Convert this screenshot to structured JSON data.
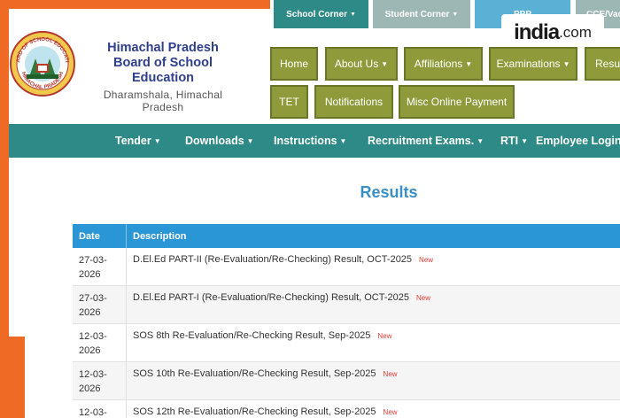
{
  "top_tabs": {
    "school_corner": "School Corner",
    "student_corner": "Student Corner",
    "c": "PPP",
    "d": "CCE/Vac"
  },
  "watermark": {
    "brand": "india",
    "suffix": ".com"
  },
  "org": {
    "line1": "Himachal Pradesh",
    "line2": "Board of School Education",
    "place": "Dharamshala, Himachal Pradesh",
    "seal_top": "BOARD OF SCHOOL EDUCATION",
    "seal_bottom": "HIMACHAL PRADESH"
  },
  "main_nav": {
    "home": "Home",
    "about": "About Us",
    "affiliations": "Affiliations",
    "examinations": "Examinations",
    "results": "Resul",
    "tet": "TET",
    "notifications": "Notifications",
    "misc": "Misc Online Payment"
  },
  "sub_nav": {
    "tender": "Tender",
    "downloads": "Downloads",
    "instructions": "Instructions",
    "recruitment": "Recruitment Exams.",
    "rti": "RTI",
    "employee": "Employee Login"
  },
  "page_title": "Results",
  "table": {
    "headers": [
      "Date",
      "Description"
    ],
    "new_badge": "New",
    "rows": [
      {
        "date1": "27-03-",
        "date2": "2026",
        "desc": "D.El.Ed PART-II (Re-Evaluation/Re-Checking) Result, OCT-2025"
      },
      {
        "date1": "27-03-",
        "date2": "2026",
        "desc": "D.El.Ed PART-I (Re-Evaluation/Re-Checking) Result, OCT-2025"
      },
      {
        "date1": "12-03-",
        "date2": "2026",
        "desc": "SOS 8th Re-Evaluation/Re-Checking Result, Sep-2025"
      },
      {
        "date1": "12-03-",
        "date2": "2026",
        "desc": "SOS 10th Re-Evaluation/Re-Checking Result, Sep-2025"
      },
      {
        "date1": "12-03-",
        "date2": "",
        "desc": "SOS 12th Re-Evaluation/Re-Checking Result, Sep-2025"
      }
    ]
  },
  "colors": {
    "frame": "#ef6a25",
    "teal": "#2d8a86",
    "olive": "#8f9b3a",
    "header_blue": "#2a96d6",
    "title_blue": "#3a8fc4",
    "new_red": "#e53935"
  }
}
